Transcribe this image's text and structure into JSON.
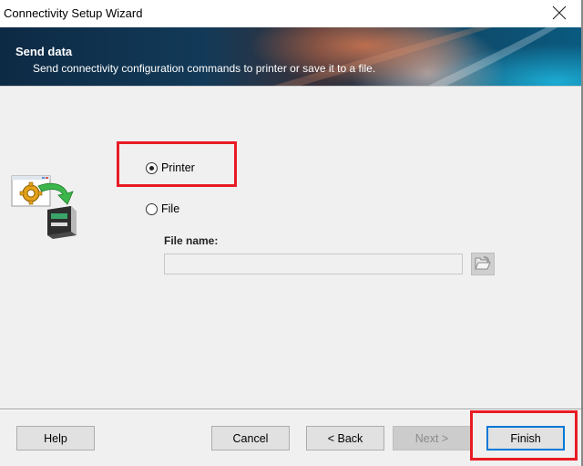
{
  "window": {
    "title": "Connectivity Setup Wizard",
    "close_icon": "close-x-icon"
  },
  "banner": {
    "title": "Send data",
    "subtitle": "Send connectivity configuration commands to printer or save it to a file."
  },
  "content": {
    "wizard_icon": "send-to-printer-icon",
    "destination_options": [
      {
        "label": "Printer",
        "selected": true
      },
      {
        "label": "File",
        "selected": false
      }
    ],
    "file_name_label": "File name:",
    "file_name_value": "",
    "browse_icon": "open-folder-icon"
  },
  "footer": {
    "help_label": "Help",
    "cancel_label": "Cancel",
    "back_label": "< Back",
    "next_label": "Next >",
    "finish_label": "Finish"
  },
  "annotations": {
    "highlight_color": "#e81c24",
    "highlighted": [
      "Printer",
      "Finish"
    ]
  }
}
